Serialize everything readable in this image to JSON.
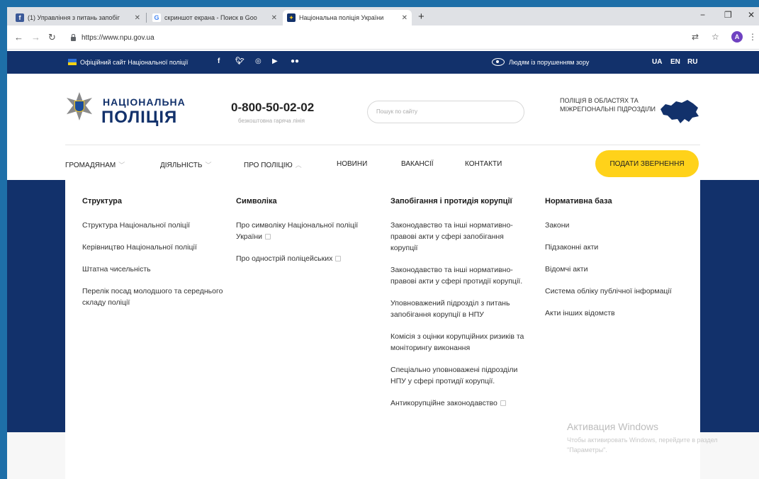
{
  "browser": {
    "tabs": [
      {
        "label": "(1) Управління з питань запобіг",
        "icon": "facebook-icon"
      },
      {
        "label": "скриншот екрана - Поиск в Goo",
        "icon": "google-icon"
      },
      {
        "label": "Національна поліція України",
        "icon": "police-icon"
      }
    ],
    "new_tab": "+",
    "url": "https://www.npu.gov.ua",
    "avatar_letter": "A"
  },
  "topbar": {
    "official": "Офіційний сайт Національної поліції",
    "vision": "Людям із порушенням зору",
    "langs": [
      "UA",
      "EN",
      "RU"
    ]
  },
  "header": {
    "logo_top": "НАЦІОНАЛЬНА",
    "logo_bottom": "ПОЛІЦІЯ",
    "phone": "0-800-50-02-02",
    "phone_sub": "безкоштовна гаряча лінія",
    "search_placeholder": "Пошук по сайту",
    "regional": "ПОЛІЦІЯ В ОБЛАСТЯХ ТА МІЖРЕГІОНАЛЬНІ ПІДРОЗДІЛИ"
  },
  "nav": {
    "items": [
      "ГРОМАДЯНАМ",
      "ДІЯЛЬНІСТЬ",
      "ПРО ПОЛІЦІЮ",
      "НОВИНИ",
      "ВАКАНСІЇ",
      "КОНТАКТИ"
    ],
    "cta": "ПОДАТИ ЗВЕРНЕННЯ"
  },
  "menu": {
    "columns": [
      {
        "title": "Структура",
        "items": [
          "Структура Національної поліції",
          "Керівництво Національної поліції",
          "Штатна чисельність",
          "Перелік посад молодшого та середнього складу поліції"
        ]
      },
      {
        "title": "Символіка",
        "items": [
          "Про символіку Національної поліції України",
          "Про однострій поліцейських"
        ]
      },
      {
        "title": "Запобігання і протидія корупції",
        "items": [
          "Законодавство та інші нормативно-правові акти у сфері запобігання корупції",
          "Законодавство та інші нормативно-правові акти у сфері протидії корупції.",
          "Уповноважений підрозділ з питань запобігання корупції в НПУ",
          "Комісія з оцінки корупційних ризиків та моніторингу виконання",
          "Спеціально уповноважені підрозділи НПУ у сфері протидії корупції.",
          "Антикорупційне законодавство"
        ]
      },
      {
        "title": "Нормативна база",
        "items": [
          "Закони",
          "Підзаконні акти",
          "Відомчі акти",
          "Система обліку публічної інформації",
          "Акти інших відомств"
        ]
      }
    ]
  },
  "watermark": {
    "title": "Активация Windows",
    "line": "Чтобы активировать Windows, перейдите в раздел \"Параметры\"."
  }
}
